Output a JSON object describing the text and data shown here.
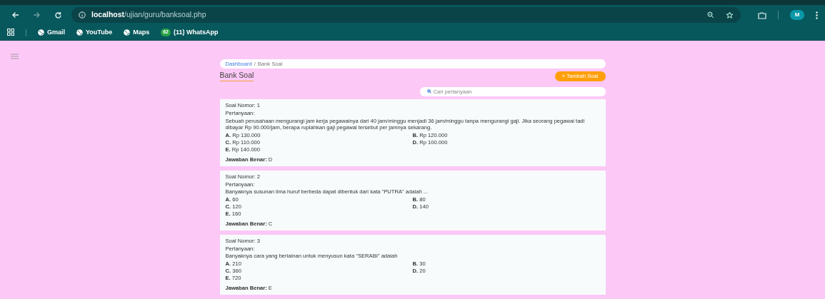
{
  "browser": {
    "url_host": "localhost",
    "url_path": "/ujian/guru/banksoal.php",
    "profile_initial": "M",
    "bookmarks": [
      {
        "label": "Gmail",
        "kind": "globe"
      },
      {
        "label": "YouTube",
        "kind": "globe"
      },
      {
        "label": "Maps",
        "kind": "globe"
      },
      {
        "label": "(11) WhatsApp",
        "kind": "badge",
        "badge": "62"
      }
    ]
  },
  "breadcrumb_separator": "/",
  "breadcrumb": [
    {
      "label": "Dashboard",
      "selected": false
    },
    {
      "label": "Bank Soal",
      "selected": true
    }
  ],
  "title": "Bank Soal",
  "add_button": "+ Tambah Soal",
  "search": {
    "placeholder": "Cari pertanyaan"
  },
  "questions": [
    {
      "number_label": "Soal Nomor: 1",
      "question_label": "Pertanyaan:",
      "text": "Sebuah perusahaan mengurangi jam kerja pegawainya dari 40 jam/minggu menjadi 36 jam/minggu tanpa mengurangi gaji. Jika seorang pegawai tadi dibayar Rp 90.000/jam, berapa rupiahkan gaji pegawai tersebut per jamnya sekarang.",
      "options": [
        {
          "letter": "A.",
          "text": "Rp 130.000"
        },
        {
          "letter": "B.",
          "text": "Rp 120.000"
        },
        {
          "letter": "C.",
          "text": "Rp 110.000"
        },
        {
          "letter": "D.",
          "text": "Rp 100.000"
        },
        {
          "letter": "E.",
          "text": "Rp 140.000"
        }
      ],
      "answer_label": "Jawaban Benar:",
      "answer": "D"
    },
    {
      "number_label": "Soal Nomor: 2",
      "question_label": "Pertanyaan:",
      "text": "Banyaknya susunan lima huruf berbeda dapat dibentuk dari kata \"PUTRA\" adalah ...",
      "options": [
        {
          "letter": "A.",
          "text": "60"
        },
        {
          "letter": "B.",
          "text": "80"
        },
        {
          "letter": "C.",
          "text": "120"
        },
        {
          "letter": "D.",
          "text": "140"
        },
        {
          "letter": "E.",
          "text": "160"
        }
      ],
      "answer_label": "Jawaban Benar:",
      "answer": "C"
    },
    {
      "number_label": "Soal Nomor: 3",
      "question_label": "Pertanyaan:",
      "text": "Banyaknya cara yang berlainan untuk menyusun kata \"SERABI\" adalah",
      "options": [
        {
          "letter": "A.",
          "text": "210"
        },
        {
          "letter": "B.",
          "text": "30"
        },
        {
          "letter": "C.",
          "text": "360"
        },
        {
          "letter": "D.",
          "text": "20"
        },
        {
          "letter": "E.",
          "text": "720"
        }
      ],
      "answer_label": "Jawaban Benar:",
      "answer": "E"
    }
  ]
}
